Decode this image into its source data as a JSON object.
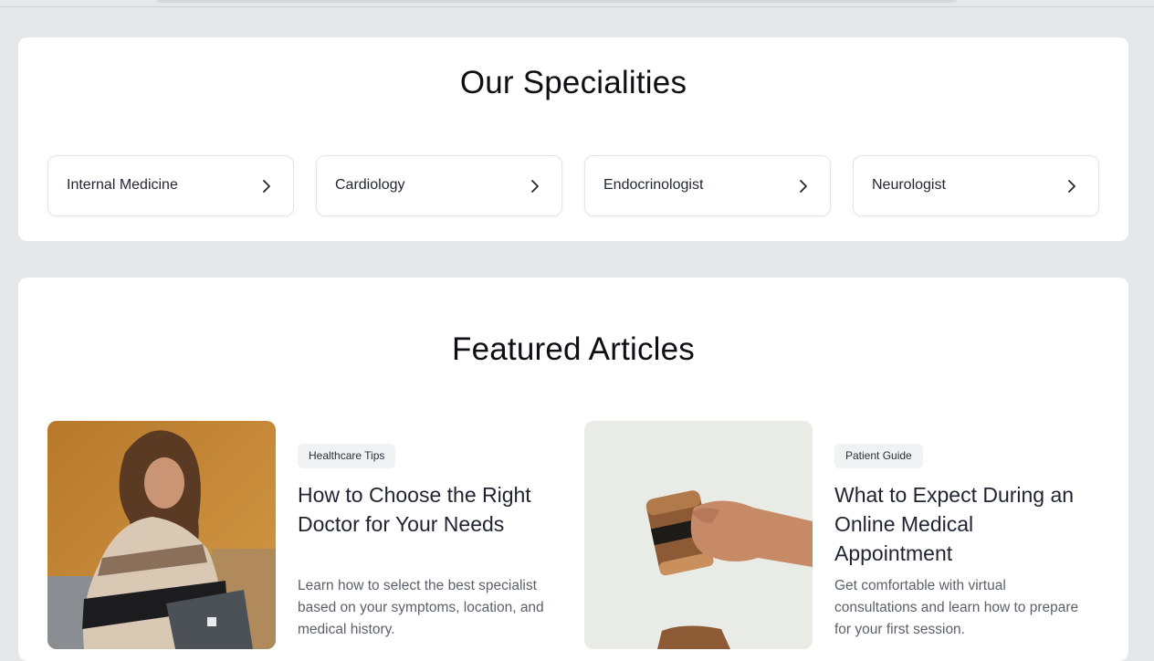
{
  "specialities": {
    "title": "Our Specialities",
    "items": [
      {
        "label": "Internal Medicine"
      },
      {
        "label": "Cardiology"
      },
      {
        "label": "Endocrinologist"
      },
      {
        "label": "Neurologist"
      }
    ]
  },
  "featured": {
    "title": "Featured Articles",
    "articles": [
      {
        "tag": "Healthcare Tips",
        "title": "How to Choose the Right Doctor for Your Needs",
        "description": "Learn how to select the best specialist based on your symptoms, location, and medical history."
      },
      {
        "tag": "Patient Guide",
        "title": "What to Expect During an Online Medical Appointment",
        "description": "Get comfortable with virtual consultations and learn how to prepare for your first session."
      }
    ]
  },
  "colors": {
    "page_bg": "#e6e7ea",
    "card_bg": "#ffffff",
    "tag_bg": "#f1f2f4",
    "heading": "#0d0f14"
  },
  "icons": {
    "speciality_arrow": "chevron-right-icon"
  }
}
